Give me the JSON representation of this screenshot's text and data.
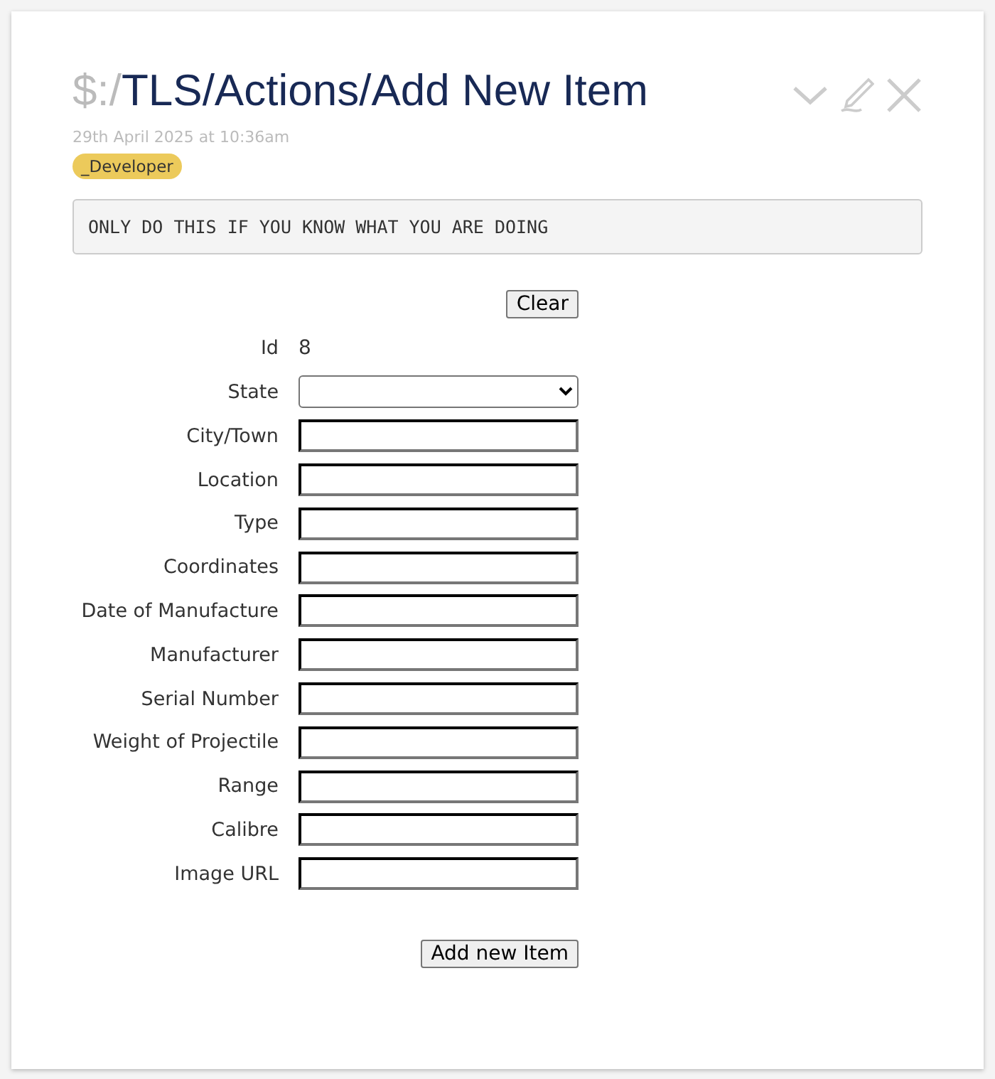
{
  "tiddler": {
    "title_prefix": "$:/",
    "title": "TLS/Actions/Add New Item",
    "modified": "29th April 2025 at 10:36am",
    "tags": [
      {
        "label": "_Developer",
        "color": "#ecca5b"
      }
    ]
  },
  "warning": "ONLY DO THIS IF YOU KNOW WHAT YOU ARE DOING",
  "clear_button": "Clear",
  "fields": [
    {
      "label": "Id",
      "kind": "value",
      "value": "8"
    },
    {
      "label": "State",
      "kind": "select"
    },
    {
      "label": "City/Town",
      "kind": "input"
    },
    {
      "label": "Location",
      "kind": "input"
    },
    {
      "label": "Type",
      "kind": "input"
    },
    {
      "label": "Coordinates",
      "kind": "input"
    },
    {
      "label": "Date of Manufacture",
      "kind": "input"
    },
    {
      "label": "Manufacturer",
      "kind": "input"
    },
    {
      "label": "Serial Number",
      "kind": "input"
    },
    {
      "label": "Weight of Projectile",
      "kind": "input"
    },
    {
      "label": "Range",
      "kind": "input"
    },
    {
      "label": "Calibre",
      "kind": "input"
    },
    {
      "label": "Image URL",
      "kind": "input"
    }
  ],
  "submit_button": "Add new Item"
}
